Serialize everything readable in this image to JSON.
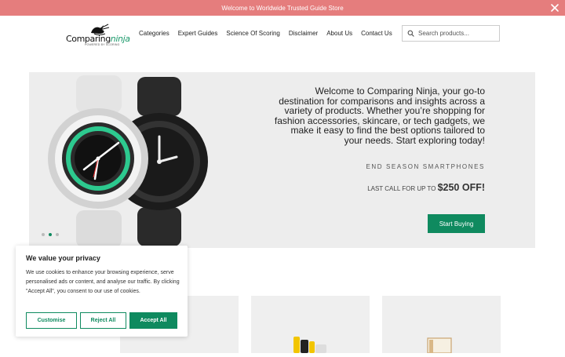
{
  "announcement": {
    "text": "Welcome to Worldwide Trusted Guide Store"
  },
  "brand": {
    "name_main": "Comparing",
    "name_accent": "ninja",
    "tagline": "POWERED BY SCORING"
  },
  "nav": {
    "items": [
      "Categories",
      "Expert Guides",
      "Science Of Scoring",
      "Disclaimer",
      "About Us",
      "Contact Us"
    ]
  },
  "search": {
    "placeholder": "Search products..."
  },
  "hero": {
    "text": "Welcome to Comparing Ninja, your go-to destination for comparisons and insights across a variety of products. Whether you’re shopping for fashion accessories, skincare, or tech gadgets, we make it easy to find the best options tailored to your needs. Start exploring today!",
    "subtitle": "END SEASON SMARTPHONES",
    "offer_prefix": "LAST CALL FOR UP TO ",
    "offer_amount": "$250 OFF!",
    "button": "Start Buying",
    "active_slide": 2,
    "slide_count": 3
  },
  "cookie": {
    "title": "We value your privacy",
    "body": "We use cookies to enhance your browsing experience, serve personalised ads or content, and analyse our traffic. By clicking \"Accept All\", you consent to our use of cookies.",
    "customise": "Customise",
    "reject": "Reject All",
    "accept": "Accept All"
  },
  "colors": {
    "accent": "#0f8a5f",
    "announce_bg": "#e57d7d",
    "hero_bg": "#ededed"
  }
}
